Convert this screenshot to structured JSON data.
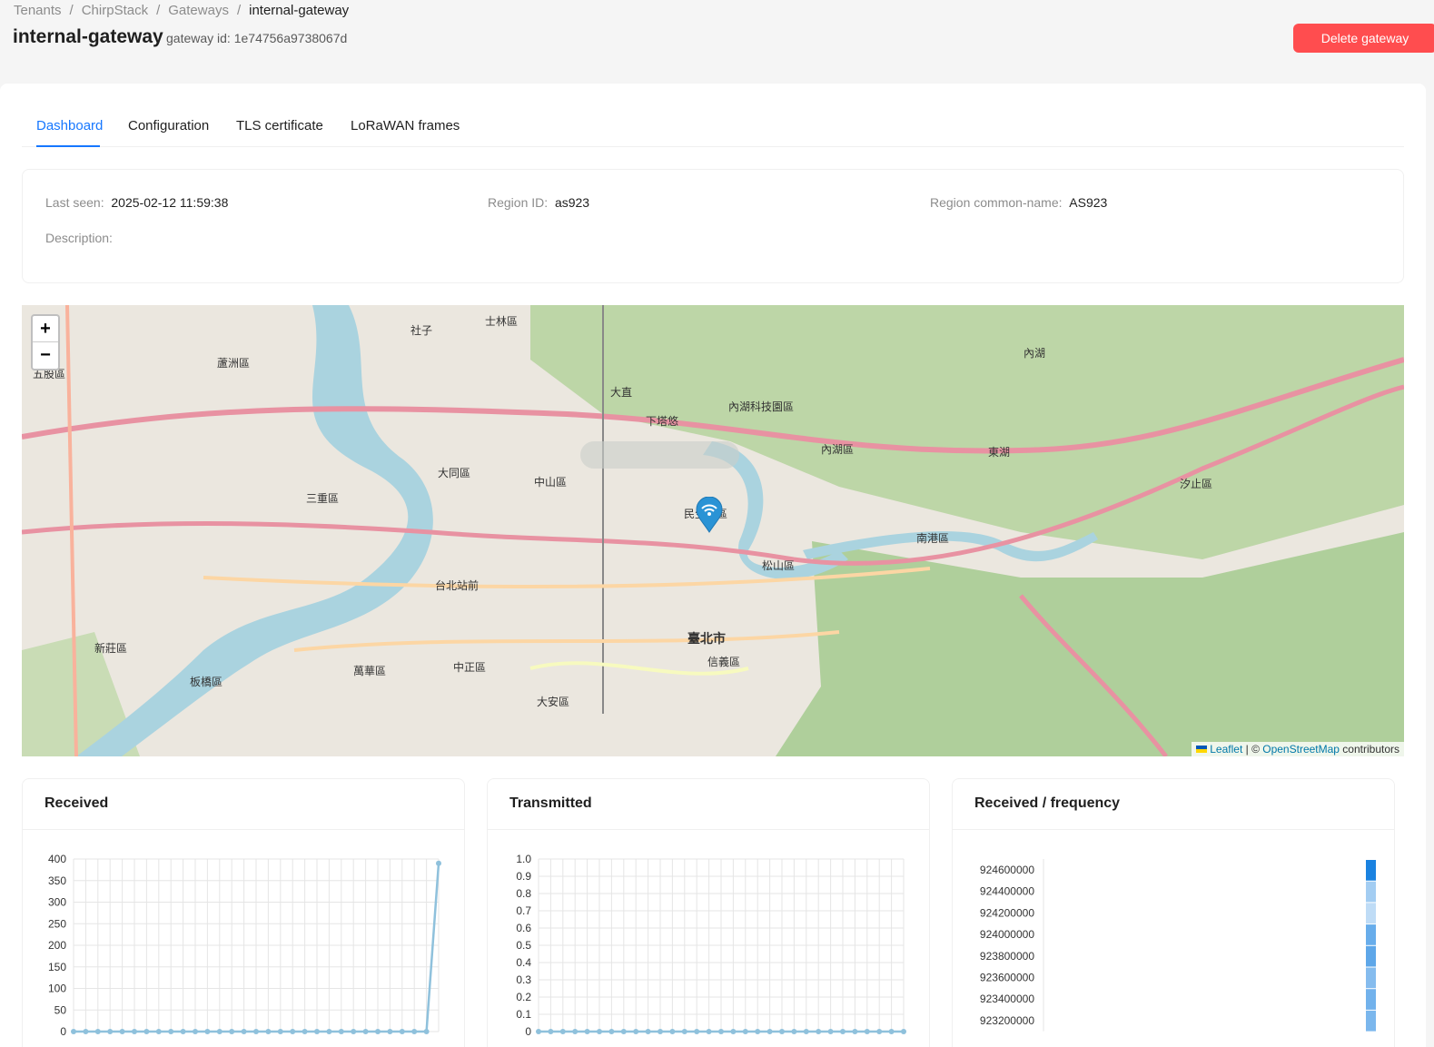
{
  "breadcrumb": [
    "Tenants",
    "ChirpStack",
    "Gateways",
    "internal-gateway"
  ],
  "page": {
    "title": "internal-gateway",
    "subtitle": "gateway id: 1e74756a9738067d",
    "delete_label": "Delete gateway"
  },
  "tabs": [
    "Dashboard",
    "Configuration",
    "TLS certificate",
    "LoRaWAN frames"
  ],
  "details": {
    "last_seen_label": "Last seen",
    "last_seen": "2025-02-12 11:59:38",
    "region_id_label": "Region ID",
    "region_id": "as923",
    "region_name_label": "Region common-name",
    "region_name": "AS923",
    "description_label": "Description"
  },
  "map": {
    "zoom_in": "+",
    "zoom_out": "−",
    "attribution_leaflet": "Leaflet",
    "attribution_sep": " | © ",
    "attribution_osm": "OpenStreetMap",
    "attribution_tail": " contributors",
    "labels": [
      "士林區",
      "大直",
      "內湖科技園區",
      "內湖區",
      "中山區",
      "大同區",
      "松山區",
      "臺北市",
      "信義區",
      "南港區",
      "汐止區",
      "萬華區",
      "中正區",
      "大安區",
      "三重區",
      "新莊區",
      "蘆洲區",
      "板橋區",
      "內湖",
      "五股區",
      "社子",
      "東湖",
      "下塔悠",
      "民生社區",
      "台北站前"
    ],
    "accent_marker": "#2a93d5"
  },
  "cards": {
    "received_title": "Received",
    "transmitted_title": "Transmitted",
    "freq_title": "Received / frequency"
  },
  "chart_data": [
    {
      "type": "line",
      "title": "Received",
      "ylim": [
        0,
        400
      ],
      "yticks": [
        "400",
        "350",
        "300",
        "250",
        "200",
        "150",
        "100",
        "50",
        "0"
      ],
      "series": [
        {
          "values": [
            0,
            0,
            0,
            0,
            0,
            0,
            0,
            0,
            0,
            0,
            0,
            0,
            0,
            0,
            0,
            0,
            0,
            0,
            0,
            0,
            0,
            0,
            0,
            0,
            0,
            0,
            0,
            0,
            0,
            0,
            390
          ]
        }
      ],
      "color": "#8fc1dc"
    },
    {
      "type": "line",
      "title": "Transmitted",
      "ylim": [
        0,
        1
      ],
      "yticks": [
        "1.0",
        "0.9",
        "0.8",
        "0.7",
        "0.6",
        "0.5",
        "0.4",
        "0.3",
        "0.2",
        "0.1",
        "0"
      ],
      "series": [
        {
          "values": [
            0,
            0,
            0,
            0,
            0,
            0,
            0,
            0,
            0,
            0,
            0,
            0,
            0,
            0,
            0,
            0,
            0,
            0,
            0,
            0,
            0,
            0,
            0,
            0,
            0,
            0,
            0,
            0,
            0,
            0,
            0
          ]
        }
      ],
      "color": "#8fc1dc"
    },
    {
      "type": "heatmap",
      "title": "Received / frequency",
      "categories": [
        "924600000",
        "924400000",
        "924200000",
        "924000000",
        "923800000",
        "923600000",
        "923400000",
        "923200000"
      ],
      "intensity": [
        1.0,
        0.3,
        0.15,
        0.6,
        0.65,
        0.45,
        0.55,
        0.5
      ],
      "color": "#1a82e0"
    }
  ]
}
